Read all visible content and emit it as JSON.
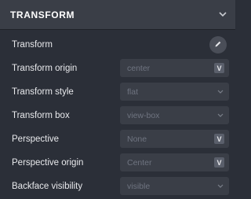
{
  "section": {
    "title": "TRANSFORM",
    "collapse_icon": "chevron-down-icon"
  },
  "rows": [
    {
      "label": "Transform",
      "control": "edit-button",
      "icon": "pencil-icon"
    },
    {
      "label": "Transform origin",
      "value": "center",
      "indicator": "V"
    },
    {
      "label": "Transform style",
      "value": "flat",
      "indicator": "chevron-down-icon"
    },
    {
      "label": "Transform box",
      "value": "view-box",
      "indicator": "chevron-down-icon"
    },
    {
      "label": "Perspective",
      "value": "None",
      "indicator": "V"
    },
    {
      "label": "Perspective origin",
      "value": "Center",
      "indicator": "V"
    },
    {
      "label": "Backface visibility",
      "value": "visible",
      "indicator": "chevron-down-icon"
    }
  ],
  "colors": {
    "panel_bg": "#2b2f38",
    "header_bg": "#3a3e47",
    "control_bg": "#3a3e47",
    "placeholder_text": "#6f7480"
  }
}
